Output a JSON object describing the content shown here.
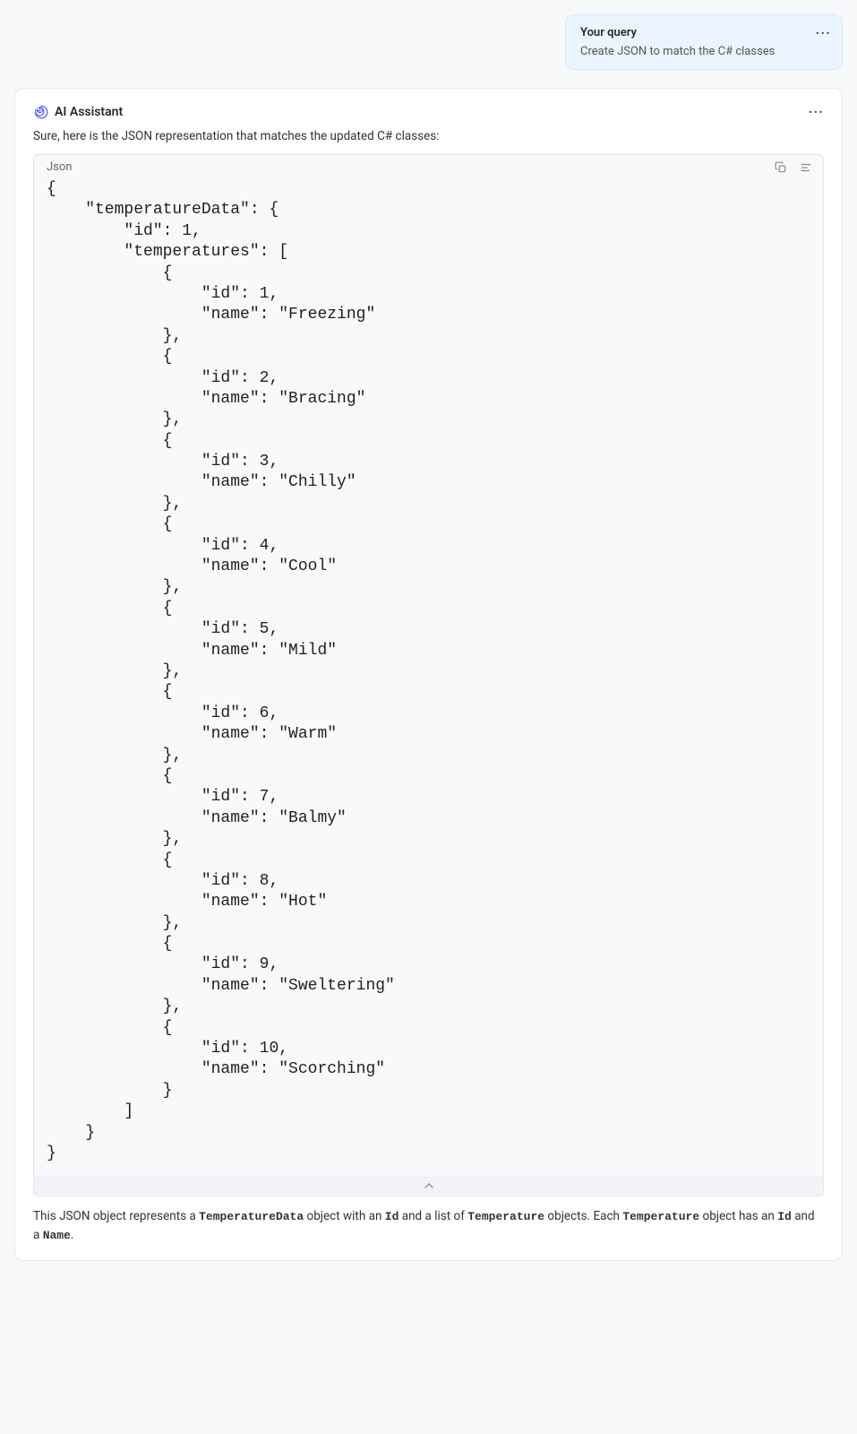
{
  "query": {
    "label": "Your query",
    "text": "Create JSON to match the C# classes"
  },
  "assistant": {
    "title": "AI Assistant",
    "intro": "Sure, here is the JSON representation that matches the updated C# classes:",
    "code_lang": "Json",
    "code": "{\n    \"temperatureData\": {\n        \"id\": 1,\n        \"temperatures\": [\n            {\n                \"id\": 1,\n                \"name\": \"Freezing\"\n            },\n            {\n                \"id\": 2,\n                \"name\": \"Bracing\"\n            },\n            {\n                \"id\": 3,\n                \"name\": \"Chilly\"\n            },\n            {\n                \"id\": 4,\n                \"name\": \"Cool\"\n            },\n            {\n                \"id\": 5,\n                \"name\": \"Mild\"\n            },\n            {\n                \"id\": 6,\n                \"name\": \"Warm\"\n            },\n            {\n                \"id\": 7,\n                \"name\": \"Balmy\"\n            },\n            {\n                \"id\": 8,\n                \"name\": \"Hot\"\n            },\n            {\n                \"id\": 9,\n                \"name\": \"Sweltering\"\n            },\n            {\n                \"id\": 10,\n                \"name\": \"Scorching\"\n            }\n        ]\n    }\n}",
    "outro_parts": {
      "t1": "This JSON object represents a ",
      "c1": "TemperatureData",
      "t2": " object with an ",
      "c2": "Id",
      "t3": " and a list of ",
      "c3": "Temperature",
      "t4": " objects. Each ",
      "c4": "Temperature",
      "t5": " object has an ",
      "c5": "Id",
      "t6": " and a ",
      "c6": "Name",
      "t7": "."
    }
  }
}
